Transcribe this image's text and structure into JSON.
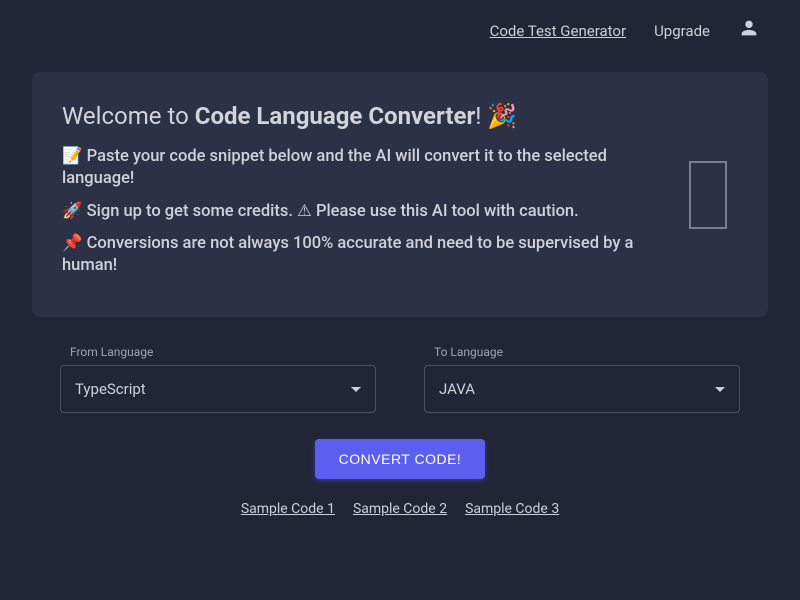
{
  "header": {
    "nav": {
      "code_test_generator": "Code Test Generator",
      "upgrade": "Upgrade"
    }
  },
  "welcome": {
    "title_prefix": "Welcome to ",
    "title_bold": "Code Language Converter",
    "title_suffix": "! 🎉",
    "line1": "📝 Paste your code snippet below and the AI will convert it to the selected language!",
    "line2": "🚀 Sign up to get some credits. ⚠ Please use this AI tool with caution.",
    "line3": "📌 Conversions are not always 100% accurate and need to be supervised by a human!"
  },
  "form": {
    "from_label": "From Language",
    "from_value": "TypeScript",
    "to_label": "To Language",
    "to_value": "JAVA",
    "convert_button": "CONVERT CODE!"
  },
  "samples": {
    "s1": "Sample Code 1",
    "s2": "Sample Code 2",
    "s3": "Sample Code 3"
  }
}
